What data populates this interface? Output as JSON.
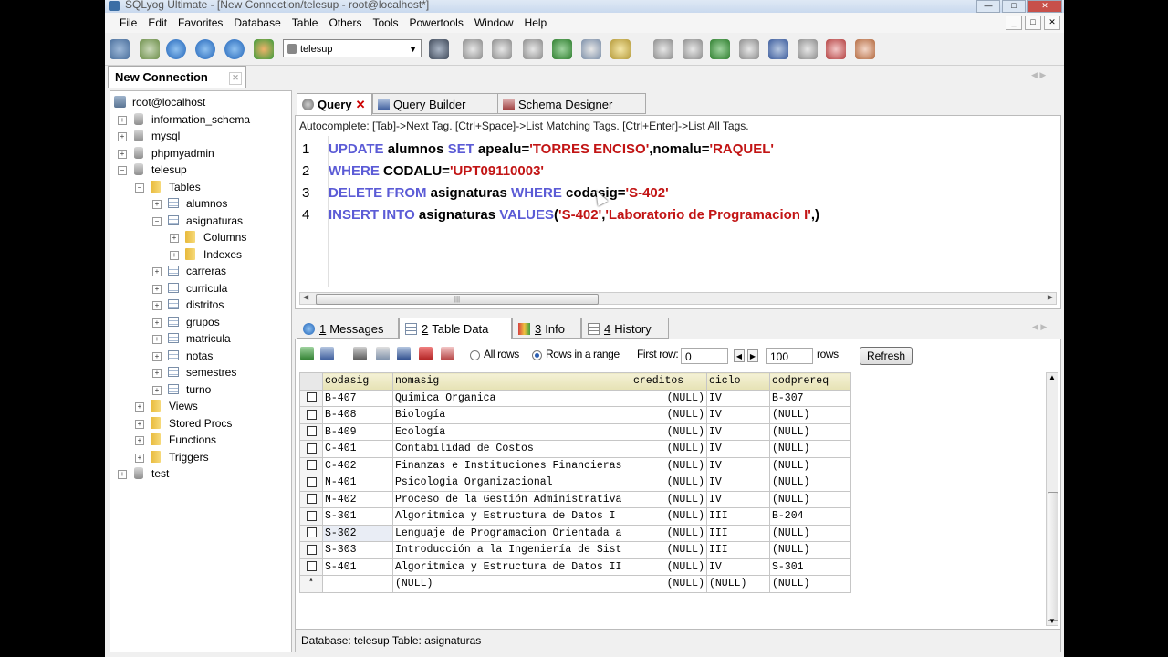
{
  "window": {
    "title": "SQLyog Ultimate - [New Connection/telesup - root@localhost*]",
    "minimize": "—",
    "maximize": "□",
    "close": "✕"
  },
  "menu": [
    "File",
    "Edit",
    "Favorites",
    "Database",
    "Table",
    "Others",
    "Tools",
    "Powertools",
    "Window",
    "Help"
  ],
  "mdi_buttons": [
    "_",
    "□",
    "✕"
  ],
  "toolbar": {
    "database_select": "telesup"
  },
  "connection_tab": {
    "label": "New Connection",
    "close": "✕"
  },
  "tree": {
    "server": "root@localhost",
    "databases": [
      {
        "name": "information_schema",
        "exp": "+"
      },
      {
        "name": "mysql",
        "exp": "+"
      },
      {
        "name": "phpmyadmin",
        "exp": "+"
      },
      {
        "name": "telesup",
        "exp": "−"
      }
    ],
    "tables_folder": "Tables",
    "tables": [
      "alumnos",
      "asignaturas",
      "carreras",
      "curricula",
      "distritos",
      "grupos",
      "matricula",
      "notas",
      "semestres",
      "turno"
    ],
    "subfolders": [
      "Columns",
      "Indexes"
    ],
    "folders": [
      "Views",
      "Stored Procs",
      "Functions",
      "Triggers"
    ],
    "extra_db": "test"
  },
  "query_tabs": [
    {
      "label": "Query",
      "close": "✕"
    },
    {
      "label": "Query Builder"
    },
    {
      "label": "Schema Designer"
    }
  ],
  "editor": {
    "autocomplete": "Autocomplete: [Tab]->Next Tag. [Ctrl+Space]->List Matching Tags. [Ctrl+Enter]->List All Tags.",
    "line_numbers": [
      "1",
      "2",
      "3",
      "4"
    ],
    "lines": [
      [
        [
          "kw",
          "UPDATE"
        ],
        [
          "id",
          " alumnos "
        ],
        [
          "kw",
          "SET"
        ],
        [
          "id",
          " apealu="
        ],
        [
          "str",
          "'TORRES ENCISO'"
        ],
        [
          "id",
          ",nomalu="
        ],
        [
          "str",
          "'RAQUEL'"
        ]
      ],
      [
        [
          "kw",
          "WHERE"
        ],
        [
          "id",
          " CODALU="
        ],
        [
          "str",
          "'UPT09110003'"
        ]
      ],
      [
        [
          "kw",
          "DELETE FROM"
        ],
        [
          "id",
          " asignaturas "
        ],
        [
          "kw",
          "WHERE"
        ],
        [
          "id",
          " codasig="
        ],
        [
          "str",
          "'S-402'"
        ]
      ],
      [
        [
          "kw",
          "INSERT INTO"
        ],
        [
          "id",
          " asignaturas "
        ],
        [
          "kw",
          "VALUES"
        ],
        [
          "id",
          "("
        ],
        [
          "str",
          "'S-402'"
        ],
        [
          "id",
          ","
        ],
        [
          "str",
          "'Laboratorio de Programacion I'"
        ],
        [
          "id",
          ",)"
        ]
      ]
    ],
    "scroll_grip": "|||"
  },
  "result_tabs": [
    {
      "num": "1",
      "label": "Messages"
    },
    {
      "num": "2",
      "label": "Table Data"
    },
    {
      "num": "3",
      "label": "Info"
    },
    {
      "num": "4",
      "label": "History"
    }
  ],
  "grid_toolbar": {
    "all_rows": "All rows",
    "rows_in_range": "Rows in a range",
    "first_row_label": "First row:",
    "first_row_value": "0",
    "rows_value": "100",
    "rows_label": "rows",
    "refresh": "Refresh"
  },
  "grid": {
    "columns": [
      "codasig",
      "nomasig",
      "creditos",
      "ciclo",
      "codprereq"
    ],
    "rows": [
      [
        "B-407",
        "Quimica Organica",
        "(NULL)",
        "IV",
        "B-307"
      ],
      [
        "B-408",
        "Biología",
        "(NULL)",
        "IV",
        "(NULL)"
      ],
      [
        "B-409",
        "Ecología",
        "(NULL)",
        "IV",
        "(NULL)"
      ],
      [
        "C-401",
        "Contabilidad de Costos",
        "(NULL)",
        "IV",
        "(NULL)"
      ],
      [
        "C-402",
        "Finanzas e Instituciones Financieras",
        "(NULL)",
        "IV",
        "(NULL)"
      ],
      [
        "N-401",
        "Psicologia Organizacional",
        "(NULL)",
        "IV",
        "(NULL)"
      ],
      [
        "N-402",
        "Proceso de la Gestión Administrativa",
        "(NULL)",
        "IV",
        "(NULL)"
      ],
      [
        "S-301",
        "Algoritmica y Estructura de Datos I",
        "(NULL)",
        "III",
        "B-204"
      ],
      [
        "S-302",
        "Lenguaje de Programacion Orientada a",
        "(NULL)",
        "III",
        "(NULL)"
      ],
      [
        "S-303",
        "Introducción a la Ingeniería de Sist",
        "(NULL)",
        "III",
        "(NULL)"
      ],
      [
        "S-401",
        "Algoritmica y Estructura de Datos II",
        "(NULL)",
        "IV",
        "S-301"
      ]
    ],
    "new_row": [
      "*",
      "",
      "(NULL)",
      "(NULL)",
      "(NULL)",
      "(NULL)"
    ]
  },
  "status": "Database: telesup  Table: asignaturas",
  "colors": {
    "keyword": "#5b5bd6",
    "string": "#c21414",
    "header": "#e6e2b4"
  }
}
